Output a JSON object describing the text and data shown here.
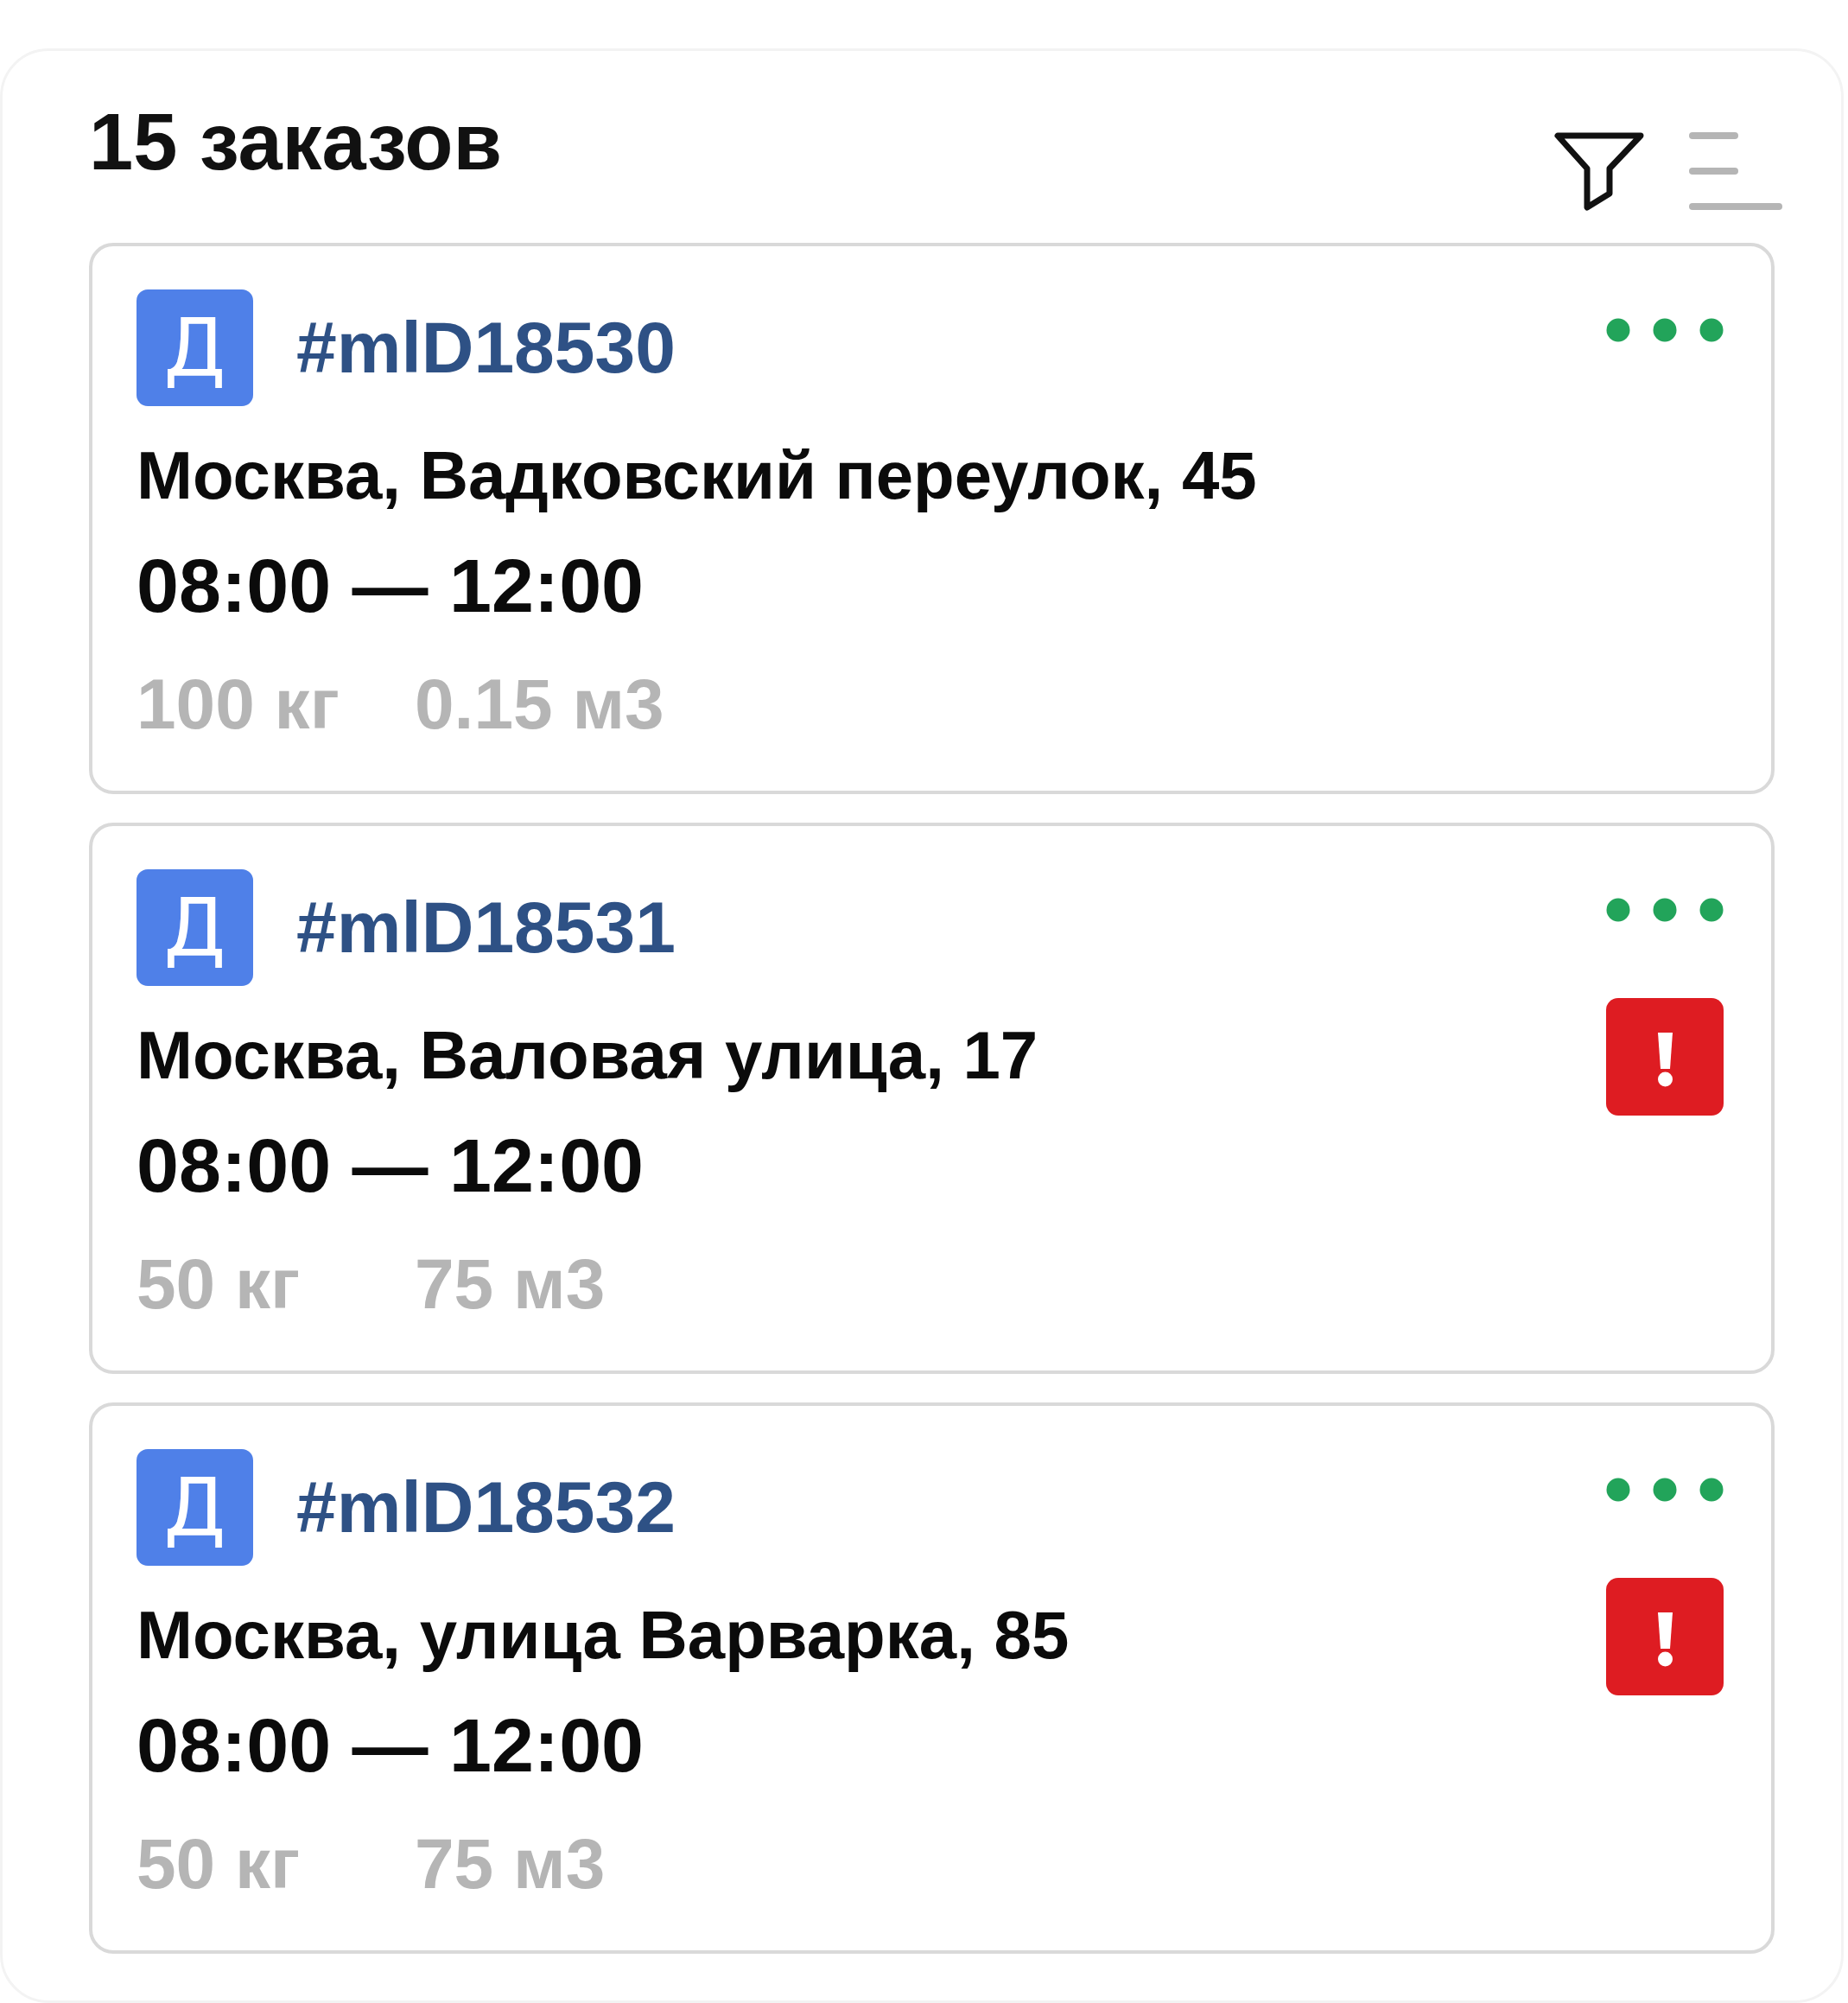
{
  "header": {
    "title": "15 заказов"
  },
  "orders": [
    {
      "badge": "Д",
      "id": "#mlD18530",
      "address": "Москва, Вадковский переулок, 45",
      "time": "08:00 — 12:00",
      "weight": "100 кг",
      "volume": "0.15 м3",
      "alert": false
    },
    {
      "badge": "Д",
      "id": "#mlD18531",
      "address": "Москва, Валовая улица, 17",
      "time": "08:00 — 12:00",
      "weight": "50 кг",
      "volume": "75 м3",
      "alert": true
    },
    {
      "badge": "Д",
      "id": "#mlD18532",
      "address": "Москва, улица Варварка, 85",
      "time": "08:00 — 12:00",
      "weight": "50 кг",
      "volume": "75 м3",
      "alert": true
    }
  ]
}
